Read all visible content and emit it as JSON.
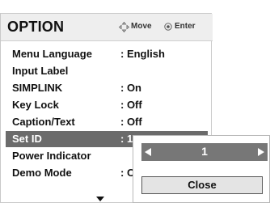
{
  "menu": {
    "title": "OPTION",
    "hint_move": "Move",
    "hint_enter": "Enter",
    "items": [
      {
        "label": "Menu Language",
        "value": ": English"
      },
      {
        "label": "Input Label",
        "value": ""
      },
      {
        "label": "SIMPLINK",
        "value": ": On"
      },
      {
        "label": "Key Lock",
        "value": ": Off"
      },
      {
        "label": "Caption/Text",
        "value": ": Off"
      },
      {
        "label": "Set ID",
        "value": ": 1"
      },
      {
        "label": "Power Indicator",
        "value": ""
      },
      {
        "label": "Demo Mode",
        "value": ": O"
      }
    ],
    "selected_index": 5
  },
  "popup": {
    "value": "1",
    "close_label": "Close"
  },
  "icons": {
    "move": "dpad-move-icon",
    "enter": "enter-circle-icon",
    "scroll": "scroll-down-arrow-icon",
    "prev": "left-arrow-icon",
    "next": "right-arrow-icon"
  },
  "colors": {
    "selected_row": "#6b6b6b",
    "header_bg": "#eeeeee",
    "selector_bg": "#777777"
  }
}
